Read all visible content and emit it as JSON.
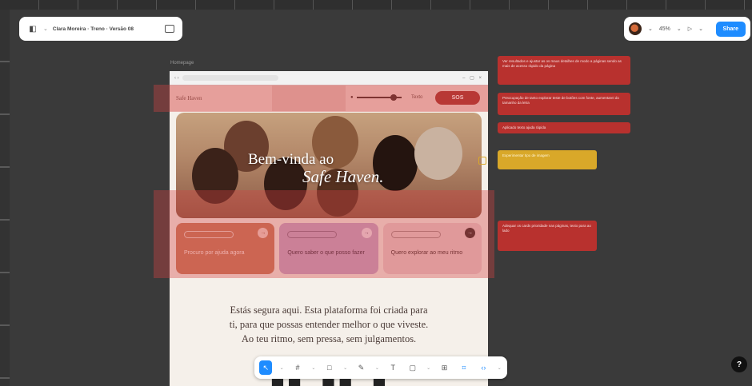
{
  "file": {
    "title": "Clara Moreira · Treno · Versão 08"
  },
  "toolbar_right": {
    "zoom": "45%",
    "share_label": "Share"
  },
  "frame": {
    "label": "Homepage"
  },
  "app": {
    "brand": "Safe Haven",
    "text_size_label": "Texto",
    "sos_label": "SOS",
    "slider_value_pct": 82,
    "hero_line1": "Bem-vinda ao",
    "hero_line2": "Safe Haven.",
    "cards": [
      {
        "text": "Procuro por ajuda agora"
      },
      {
        "text": "Quero saber o que posso fazer"
      },
      {
        "text": "Quero explorar ao meu ritmo"
      }
    ],
    "body_lines": [
      "Estás segura aqui. Esta plataforma foi criada para",
      "ti, para que possas entender melhor o que viveste.",
      "Ao teu ritmo, sem pressa, sem julgamentos."
    ]
  },
  "annotations": [
    {
      "text": "Ver resultados e ajustar as os maus detalhes de modo a páginas sendo as mais de acesso ràpido da página",
      "color": "#b8312e"
    },
    {
      "text": "Preocupação de tanto explorar teste de botões com fonte, aumentarei do tamanho da letra",
      "color": "#b8312e"
    },
    {
      "text": "Aplicado texto ajuda rápida",
      "color": "#b8312e"
    },
    {
      "text": "Experimentar tipo de imagem",
      "color": "#d9a829"
    },
    {
      "text": "Adequar os cards prioridade nas páginas, texto para ao lado",
      "color": "#b8312e"
    }
  ],
  "icons": {
    "menu": "figma-logo-icon",
    "panel": "panel-toggle-icon",
    "play": "play-icon",
    "help": "help-icon"
  },
  "help_label": "?"
}
